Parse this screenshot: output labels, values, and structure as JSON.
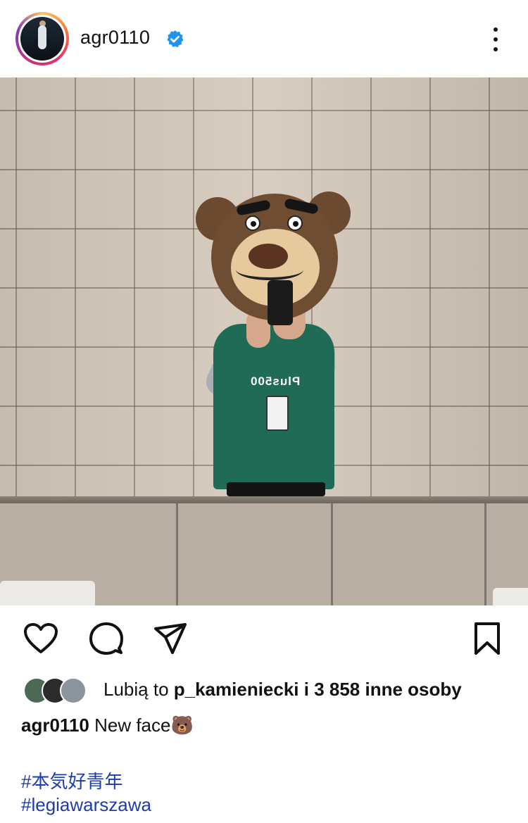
{
  "post": {
    "username": "agr0110",
    "verified_icon": "verified-badge-icon",
    "menu_icon": "more-vertical-icon",
    "photo": {
      "sponsor_text": "Plus500"
    }
  },
  "actions": {
    "like_icon": "heart-icon",
    "comment_icon": "comment-icon",
    "share_icon": "send-icon",
    "save_icon": "bookmark-icon"
  },
  "likes": {
    "prefix": "Lubią to ",
    "user": "p_kamieniecki",
    "suffix": " i 3 858 inne osoby"
  },
  "caption": {
    "user": "agr0110",
    "text": " New face🐻"
  },
  "hashtags": [
    "#本気好青年",
    "#legiawarszawa"
  ],
  "colors": {
    "verified": "#1e96f0",
    "hashtag": "#1d3ea8",
    "text": "#111111"
  }
}
